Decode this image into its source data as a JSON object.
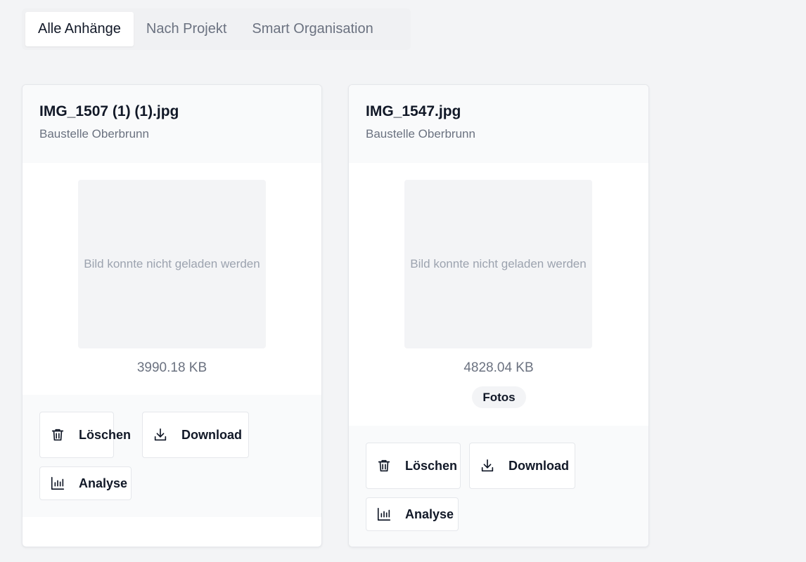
{
  "tabs": [
    {
      "label": "Alle Anhänge",
      "active": true
    },
    {
      "label": "Nach Projekt",
      "active": false
    },
    {
      "label": "Smart Organisation",
      "active": false
    }
  ],
  "attachments": [
    {
      "filename": "IMG_1507 (1) (1).jpg",
      "project": "Baustelle Oberbrunn",
      "image_placeholder": "Bild konnte nicht geladen werden",
      "size": "3990.18 KB",
      "tag": null,
      "actions": {
        "delete": "Löschen",
        "download": "Download",
        "analyse": "Analyse"
      }
    },
    {
      "filename": "IMG_1547.jpg",
      "project": "Baustelle Oberbrunn",
      "image_placeholder": "Bild konnte nicht geladen werden",
      "size": "4828.04 KB",
      "tag": "Fotos",
      "actions": {
        "delete": "Löschen",
        "download": "Download",
        "analyse": "Analyse"
      }
    }
  ],
  "icons": {
    "delete": "trash-icon",
    "download": "download-icon",
    "analyse": "bar-chart-icon"
  }
}
